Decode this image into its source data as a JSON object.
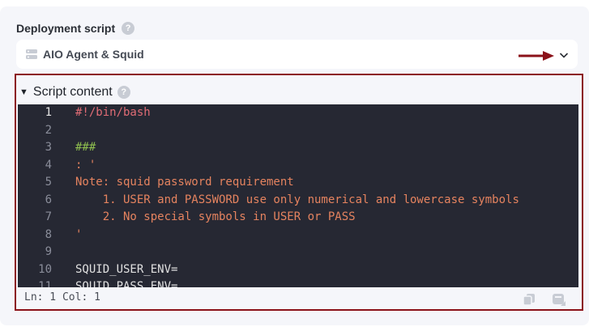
{
  "field": {
    "label": "Deployment script",
    "help_glyph": "?"
  },
  "select": {
    "value": "AIO Agent & Squid",
    "icon": "server-icon",
    "chevron": "chevron-down-icon"
  },
  "section": {
    "toggle_glyph": "▼",
    "title": "Script content",
    "help_glyph": "?"
  },
  "editor": {
    "lines": [
      {
        "num": "1",
        "text": "#!/bin/bash",
        "type": "shebang"
      },
      {
        "num": "2",
        "text": "",
        "type": "plain"
      },
      {
        "num": "3",
        "text": "###",
        "type": "comment"
      },
      {
        "num": "4",
        "text": ": '",
        "type": "string"
      },
      {
        "num": "5",
        "text": "Note: squid password requirement",
        "type": "string"
      },
      {
        "num": "6",
        "text": "    1. USER and PASSWORD use only numerical and lowercase symbols",
        "type": "string"
      },
      {
        "num": "7",
        "text": "    2. No special symbols in USER or PASS",
        "type": "string"
      },
      {
        "num": "8",
        "text": "'",
        "type": "string"
      },
      {
        "num": "9",
        "text": "",
        "type": "plain"
      },
      {
        "num": "10",
        "text": "SQUID_USER_ENV=",
        "type": "plain"
      },
      {
        "num": "11",
        "text": "SQUID_PASS_ENV=",
        "type": "plain"
      }
    ]
  },
  "status": {
    "position": "Ln: 1  Col: 1"
  },
  "colors": {
    "annotation": "#8b1119",
    "editor_bg": "#262833"
  }
}
